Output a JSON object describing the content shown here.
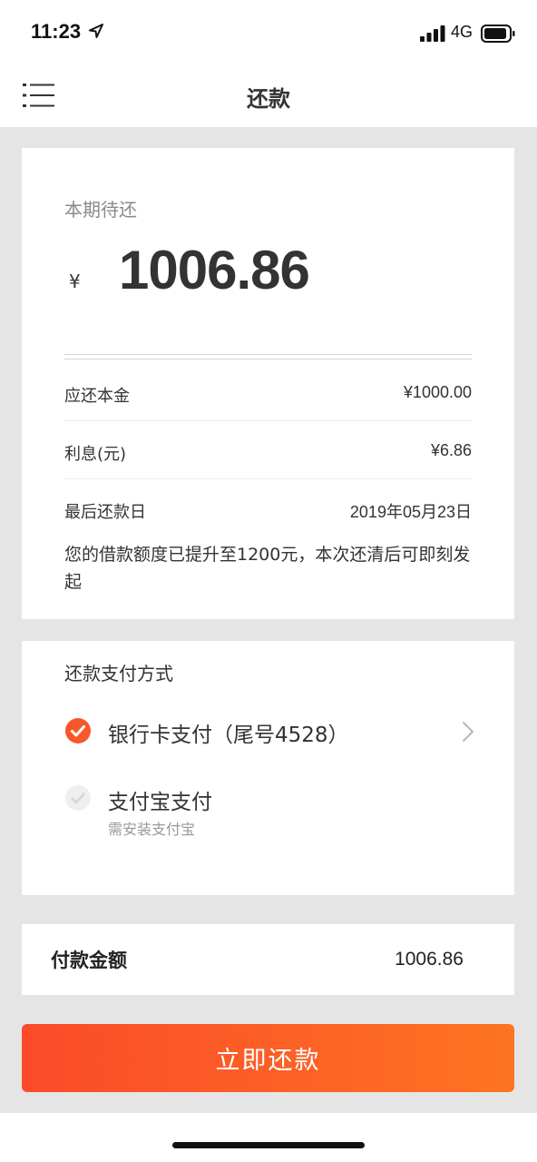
{
  "status_bar": {
    "time": "11:23",
    "network": "4G",
    "icons": [
      "location-arrow-icon",
      "signal-icon",
      "battery-icon"
    ]
  },
  "nav": {
    "title": "还款",
    "menu_icon": "menu-icon"
  },
  "due": {
    "label": "本期待还",
    "currency": "¥",
    "amount": "1006.86",
    "rows": [
      {
        "label": "应还本金",
        "value": "¥1000.00"
      },
      {
        "label": "利息(元)",
        "value": "¥6.86"
      },
      {
        "label": "最后还款日",
        "value": "2019年05月23日"
      }
    ],
    "notice": "您的借款额度已提升至1200元，本次还清后可即刻发起"
  },
  "payment": {
    "label": "还款支付方式",
    "methods": [
      {
        "name": "银行卡支付（尾号4528）",
        "selected": true
      },
      {
        "name": "支付宝支付",
        "sub": "需安装支付宝",
        "selected": false
      }
    ]
  },
  "total": {
    "label": "付款金额",
    "amount": "1006.86"
  },
  "button": {
    "label": "立即还款"
  },
  "colors": {
    "accent": "#fb4a2a",
    "accent_end": "#fd7421",
    "background": "#e5e5e5"
  }
}
